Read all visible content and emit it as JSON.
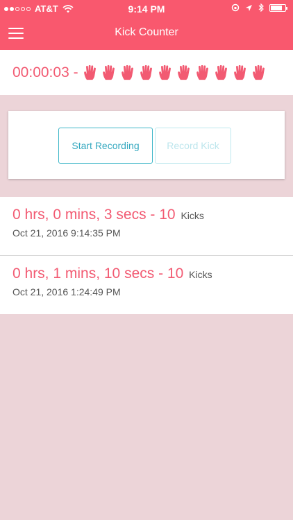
{
  "status_bar": {
    "carrier": "AT&T",
    "time": "9:14 PM"
  },
  "header": {
    "title": "Kick Counter",
    "menu_icon": "hamburger-menu-icon",
    "background_color": "#f9586e"
  },
  "timer": {
    "elapsed": "00:00:03 -",
    "kick_count": 10,
    "kick_icon": "hand-icon",
    "accent_color": "#f25a72"
  },
  "controls": {
    "start_label": "Start Recording",
    "record_kick_label": "Record Kick",
    "button_color": "#36a9c0"
  },
  "records": [
    {
      "duration": "0 hrs, 0 mins, 3 secs - 10",
      "kicks_label": "Kicks",
      "timestamp": "Oct 21, 2016 9:14:35 PM"
    },
    {
      "duration": "0 hrs, 1 mins, 10 secs - 10",
      "kicks_label": "Kicks",
      "timestamp": "Oct 21, 2016 1:24:49 PM"
    }
  ]
}
